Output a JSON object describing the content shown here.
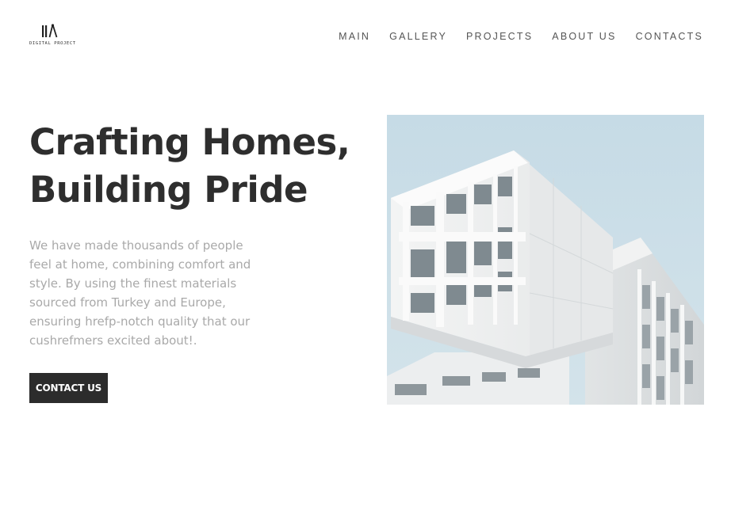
{
  "brand": {
    "logo_text": "DIGITAL PROJECT",
    "logo_icon": "architect-compass-logo"
  },
  "nav": {
    "items": [
      {
        "label": "MAIN"
      },
      {
        "label": "GALLERY"
      },
      {
        "label": "PROJECTS"
      },
      {
        "label": "ABOUT US"
      },
      {
        "label": "CONTACTS"
      }
    ]
  },
  "hero": {
    "title_line1": "Crafting Homes,",
    "title_line2": "Building Pride",
    "description": "We have made thousands of people feel at home, combining comfort and style. By using the finest materials sourced from Turkey and Europe, ensuring hrefp-notch quality that our cushrefmers excited about!.",
    "cta_label": "CONTACT US",
    "image_subject": "white modern apartment building against pale blue sky"
  },
  "colors": {
    "text_dark": "#2e2e2e",
    "text_muted": "#a9a9a9",
    "button_bg": "#2c2c2c",
    "sky": "#c9dde7"
  }
}
